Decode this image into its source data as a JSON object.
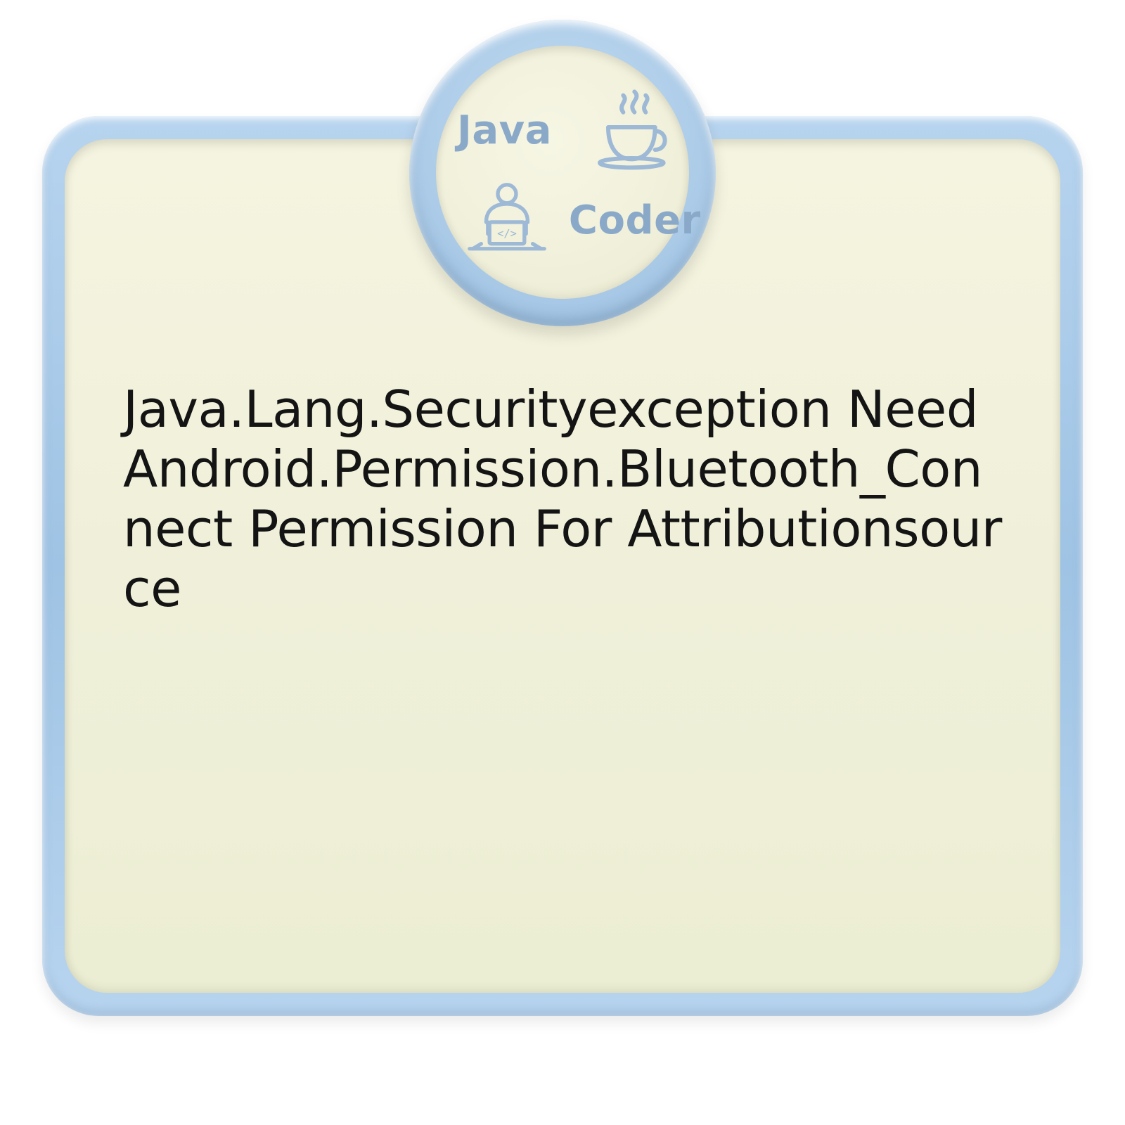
{
  "badge": {
    "text_top": "Java",
    "text_bottom": "Coder",
    "icon_coffee": "java-coffee-icon",
    "icon_coder": "coder-person-icon"
  },
  "content": {
    "message": "Java.Lang.Securityexception Need Android.Permission.Bluetooth_Connect Permission For Attributionsource"
  },
  "colors": {
    "frame_blue": "#a8cae8",
    "panel_cream": "#f1f1dc",
    "text_dark": "#141414",
    "logo_tint": "#8aa9c9"
  }
}
